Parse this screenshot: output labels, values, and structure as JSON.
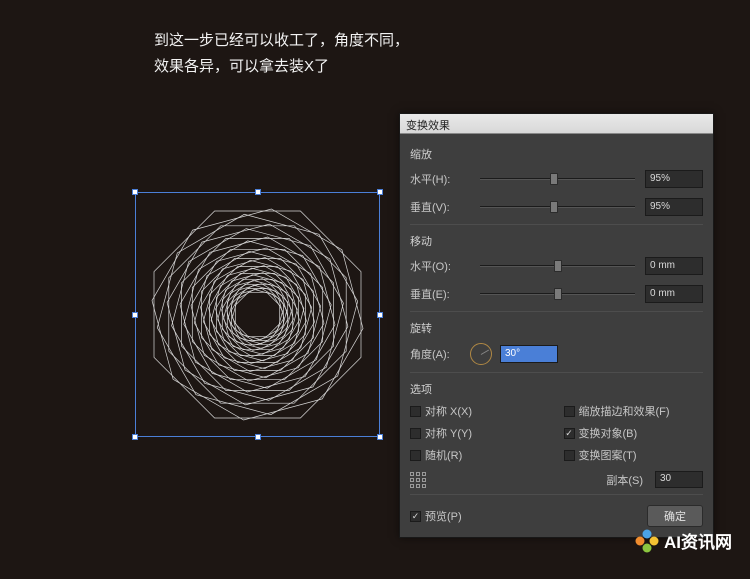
{
  "caption": {
    "line1": "到这一步已经可以收工了，角度不同，",
    "line2": "效果各异，可以拿去装X了"
  },
  "dialog": {
    "title": "变换效果",
    "scale": {
      "title": "缩放",
      "horizontal_label": "水平(H):",
      "horizontal_value": "95%",
      "vertical_label": "垂直(V):",
      "vertical_value": "95%"
    },
    "move": {
      "title": "移动",
      "horizontal_label": "水平(O):",
      "horizontal_value": "0 mm",
      "vertical_label": "垂直(E):",
      "vertical_value": "0 mm"
    },
    "rotate": {
      "title": "旋转",
      "angle_label": "角度(A):",
      "angle_value": "30°"
    },
    "options": {
      "title": "选项",
      "reflect_x": "对称 X(X)",
      "reflect_y": "对称 Y(Y)",
      "random": "随机(R)",
      "scale_strokes": "缩放描边和效果(F)",
      "transform_objects": "变换对象(B)",
      "transform_patterns": "变换图案(T)",
      "transform_objects_checked": true
    },
    "copies": {
      "label": "副本(S)",
      "value": "30"
    },
    "preview_label": "预览(P)",
    "preview_checked": true,
    "ok_label": "确定"
  },
  "watermark": {
    "text": "AI资讯网"
  }
}
